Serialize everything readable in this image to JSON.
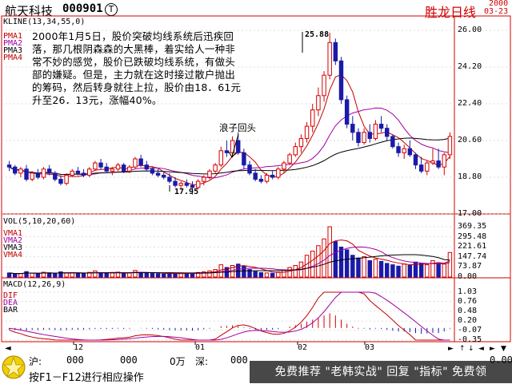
{
  "header": {
    "name": "航天科技",
    "code": "000901",
    "t_icon": "T",
    "title": "胜龙日线",
    "date_year": "2000",
    "date_md": "03-23"
  },
  "kline": {
    "label": "KLINE(13,34,55,0)",
    "pma": [
      "PMA1",
      "PMA2",
      "PMA3",
      "PMA4"
    ],
    "y_ticks": [
      "26.00",
      "24.20",
      "22.40",
      "20.60",
      "18.80",
      "17.00"
    ],
    "high_label": "25.88",
    "low_label": "17.95",
    "note": "2000年1月5日，股价突破均线系统后迅疾回落，那几根阴森森的大黑棒，着实给人一种非常不妙的感觉，股价已跌破均线系统，有做头部的嫌疑。但是，主力就在这时接过散户抛出的筹码，然后转身就往上拉，股价由18．61元升至26．13元，涨幅40%。",
    "wave_label": "浪子回头"
  },
  "volume": {
    "label": "VOL(5,10,20,60)",
    "vma": [
      "VMA1",
      "VMA2",
      "VMA3",
      "VMA4"
    ],
    "y_ticks": [
      "369.35",
      "295.48",
      "221.61",
      "147.74",
      "73.87",
      "0.00"
    ]
  },
  "macd": {
    "label": "MACD(12,26,9)",
    "lines": [
      "DIF",
      "DEA",
      "BAR"
    ],
    "y_ticks": [
      "1.03",
      "0.76",
      "0.48",
      "0.20",
      "-0.07",
      "-0.35"
    ]
  },
  "time_axis": {
    "labels": [
      "12",
      "01",
      "02",
      "03"
    ]
  },
  "status": {
    "sh_label": "沪:",
    "sh_v1": "000",
    "sh_v2": "000",
    "wan": "0万",
    "sz_label": "深:",
    "sz_v1": "000",
    "tail1": "0.00",
    "hint": "按F1－F12进行相应操作",
    "watermark": "免费推荐 \"老韩实战\" 回复 \"指标\" 免费领"
  },
  "colors": {
    "up": "#d40000",
    "down": "#1a1aa8",
    "ma1": "#c00000",
    "ma2": "#a000a0",
    "ma3": "#000000",
    "ma4": "#000000",
    "frame": "#d00000"
  },
  "chart_data": [
    {
      "type": "candlestick",
      "title": "KLINE(13,34,55,0)",
      "ylim": [
        17.0,
        26.0
      ],
      "x_labels": [
        "12",
        "01",
        "02",
        "03"
      ],
      "series_names": [
        "PMA1",
        "PMA2",
        "PMA3",
        "PMA4"
      ],
      "annotations": [
        "25.88",
        "17.95",
        "浪子回头"
      ],
      "ohlc": [
        [
          19.4,
          19.6,
          19.1,
          19.3
        ],
        [
          19.3,
          19.4,
          18.9,
          19.0
        ],
        [
          19.0,
          19.3,
          18.8,
          19.2
        ],
        [
          19.2,
          19.4,
          18.6,
          18.7
        ],
        [
          18.7,
          19.1,
          18.6,
          19.0
        ],
        [
          19.0,
          19.2,
          18.7,
          18.8
        ],
        [
          18.8,
          19.3,
          18.7,
          19.2
        ],
        [
          19.2,
          19.4,
          18.9,
          19.0
        ],
        [
          19.0,
          19.1,
          18.6,
          18.7
        ],
        [
          18.7,
          18.9,
          18.4,
          18.5
        ],
        [
          18.5,
          19.0,
          18.4,
          18.9
        ],
        [
          18.9,
          19.2,
          18.8,
          19.1
        ],
        [
          19.1,
          19.3,
          18.9,
          19.0
        ],
        [
          19.0,
          19.2,
          18.8,
          18.9
        ],
        [
          18.9,
          19.3,
          18.8,
          19.2
        ],
        [
          19.2,
          19.6,
          19.1,
          19.5
        ],
        [
          19.5,
          19.7,
          19.2,
          19.3
        ],
        [
          19.3,
          19.5,
          19.0,
          19.1
        ],
        [
          19.1,
          19.3,
          18.9,
          19.2
        ],
        [
          19.2,
          19.5,
          19.1,
          19.4
        ],
        [
          19.4,
          19.5,
          19.0,
          19.1
        ],
        [
          19.1,
          19.4,
          19.0,
          19.3
        ],
        [
          19.3,
          19.8,
          19.2,
          19.7
        ],
        [
          19.7,
          19.9,
          19.3,
          19.4
        ],
        [
          19.4,
          19.6,
          19.1,
          19.2
        ],
        [
          19.2,
          19.3,
          18.9,
          19.0
        ],
        [
          19.0,
          19.2,
          18.8,
          18.9
        ],
        [
          18.9,
          19.1,
          18.7,
          18.8
        ],
        [
          18.8,
          19.0,
          18.5,
          18.6
        ],
        [
          18.6,
          18.8,
          18.3,
          18.4
        ],
        [
          18.4,
          18.6,
          18.2,
          18.5
        ],
        [
          18.5,
          18.7,
          18.3,
          18.4
        ],
        [
          18.4,
          18.6,
          17.95,
          18.3
        ],
        [
          18.3,
          18.7,
          18.2,
          18.6
        ],
        [
          18.6,
          18.9,
          18.4,
          18.8
        ],
        [
          18.8,
          19.2,
          18.7,
          19.1
        ],
        [
          19.1,
          19.5,
          19.0,
          19.4
        ],
        [
          19.4,
          20.3,
          19.3,
          20.1
        ],
        [
          20.1,
          20.6,
          19.8,
          20.0
        ],
        [
          20.0,
          20.8,
          19.9,
          20.6
        ],
        [
          20.6,
          21.0,
          19.9,
          20.0
        ],
        [
          20.0,
          20.2,
          19.2,
          19.4
        ],
        [
          19.4,
          19.6,
          18.9,
          19.0
        ],
        [
          19.0,
          19.2,
          18.6,
          18.7
        ],
        [
          18.7,
          18.9,
          18.5,
          18.6
        ],
        [
          18.6,
          19.0,
          18.5,
          18.9
        ],
        [
          18.9,
          19.1,
          18.7,
          18.8
        ],
        [
          18.8,
          19.3,
          18.7,
          19.2
        ],
        [
          19.2,
          19.6,
          19.0,
          19.5
        ],
        [
          19.5,
          20.0,
          19.4,
          19.9
        ],
        [
          19.9,
          20.5,
          19.8,
          20.3
        ],
        [
          20.3,
          20.9,
          20.0,
          20.7
        ],
        [
          20.7,
          21.5,
          20.5,
          21.3
        ],
        [
          21.3,
          22.4,
          21.0,
          22.1
        ],
        [
          22.1,
          23.2,
          21.8,
          22.8
        ],
        [
          22.8,
          24.0,
          22.5,
          23.8
        ],
        [
          23.8,
          25.88,
          23.6,
          25.4
        ],
        [
          25.4,
          25.6,
          24.3,
          24.5
        ],
        [
          24.5,
          24.7,
          22.4,
          22.6
        ],
        [
          22.6,
          22.8,
          21.2,
          21.4
        ],
        [
          21.4,
          21.8,
          20.6,
          21.0
        ],
        [
          21.0,
          21.2,
          20.3,
          20.5
        ],
        [
          20.5,
          21.2,
          20.4,
          21.0
        ],
        [
          21.0,
          21.4,
          20.5,
          20.7
        ],
        [
          20.7,
          21.6,
          20.6,
          21.4
        ],
        [
          21.4,
          21.8,
          21.0,
          21.2
        ],
        [
          21.2,
          21.4,
          20.6,
          20.8
        ],
        [
          20.8,
          20.9,
          20.2,
          20.3
        ],
        [
          20.3,
          20.5,
          19.8,
          20.0
        ],
        [
          20.0,
          20.4,
          19.7,
          20.2
        ],
        [
          20.2,
          20.6,
          19.8,
          19.9
        ],
        [
          19.9,
          20.0,
          19.2,
          19.4
        ],
        [
          19.4,
          19.8,
          19.0,
          19.1
        ],
        [
          19.1,
          19.6,
          18.9,
          19.5
        ],
        [
          19.5,
          20.2,
          19.4,
          19.6
        ],
        [
          19.6,
          20.2,
          19.2,
          19.3
        ],
        [
          19.3,
          20.0,
          18.9,
          19.9
        ],
        [
          19.9,
          21.0,
          19.7,
          20.8
        ]
      ]
    },
    {
      "type": "bar",
      "title": "VOL(5,10,20,60)",
      "ylim": [
        0,
        369.35
      ],
      "series_names": [
        "VMA1",
        "VMA2",
        "VMA3",
        "VMA4"
      ],
      "values": [
        30,
        22,
        25,
        40,
        28,
        24,
        35,
        30,
        26,
        38,
        29,
        33,
        27,
        25,
        34,
        45,
        31,
        28,
        30,
        36,
        27,
        30,
        48,
        33,
        29,
        26,
        24,
        22,
        30,
        28,
        25,
        27,
        24,
        33,
        38,
        45,
        55,
        90,
        70,
        85,
        95,
        80,
        55,
        40,
        32,
        30,
        28,
        35,
        50,
        70,
        85,
        110,
        160,
        190,
        230,
        280,
        369,
        260,
        220,
        200,
        160,
        140,
        150,
        120,
        130,
        115,
        100,
        90,
        80,
        95,
        85,
        110,
        100,
        90,
        120,
        105,
        95,
        180
      ]
    },
    {
      "type": "bar",
      "title": "MACD(12,26,9)",
      "ylim": [
        -0.35,
        1.03
      ],
      "series_names": [
        "DIF",
        "DEA",
        "BAR"
      ],
      "values": [
        -0.05,
        -0.06,
        -0.05,
        -0.07,
        -0.06,
        -0.06,
        -0.05,
        -0.05,
        -0.06,
        -0.07,
        -0.06,
        -0.05,
        -0.05,
        -0.05,
        -0.04,
        -0.03,
        -0.03,
        -0.03,
        -0.03,
        -0.02,
        -0.03,
        -0.02,
        0.0,
        -0.01,
        -0.02,
        -0.03,
        -0.04,
        -0.05,
        -0.06,
        -0.07,
        -0.07,
        -0.07,
        -0.08,
        -0.06,
        -0.04,
        -0.02,
        0.0,
        0.05,
        0.06,
        0.08,
        0.06,
        0.02,
        -0.02,
        -0.05,
        -0.06,
        -0.05,
        -0.05,
        -0.03,
        0.0,
        0.04,
        0.08,
        0.12,
        0.18,
        0.24,
        0.3,
        0.36,
        0.42,
        0.36,
        0.24,
        0.12,
        0.04,
        -0.02,
        -0.02,
        -0.04,
        -0.02,
        -0.03,
        -0.05,
        -0.08,
        -0.1,
        -0.1,
        -0.12,
        -0.15,
        -0.17,
        -0.16,
        -0.14,
        -0.15,
        -0.1,
        -0.02
      ]
    }
  ]
}
